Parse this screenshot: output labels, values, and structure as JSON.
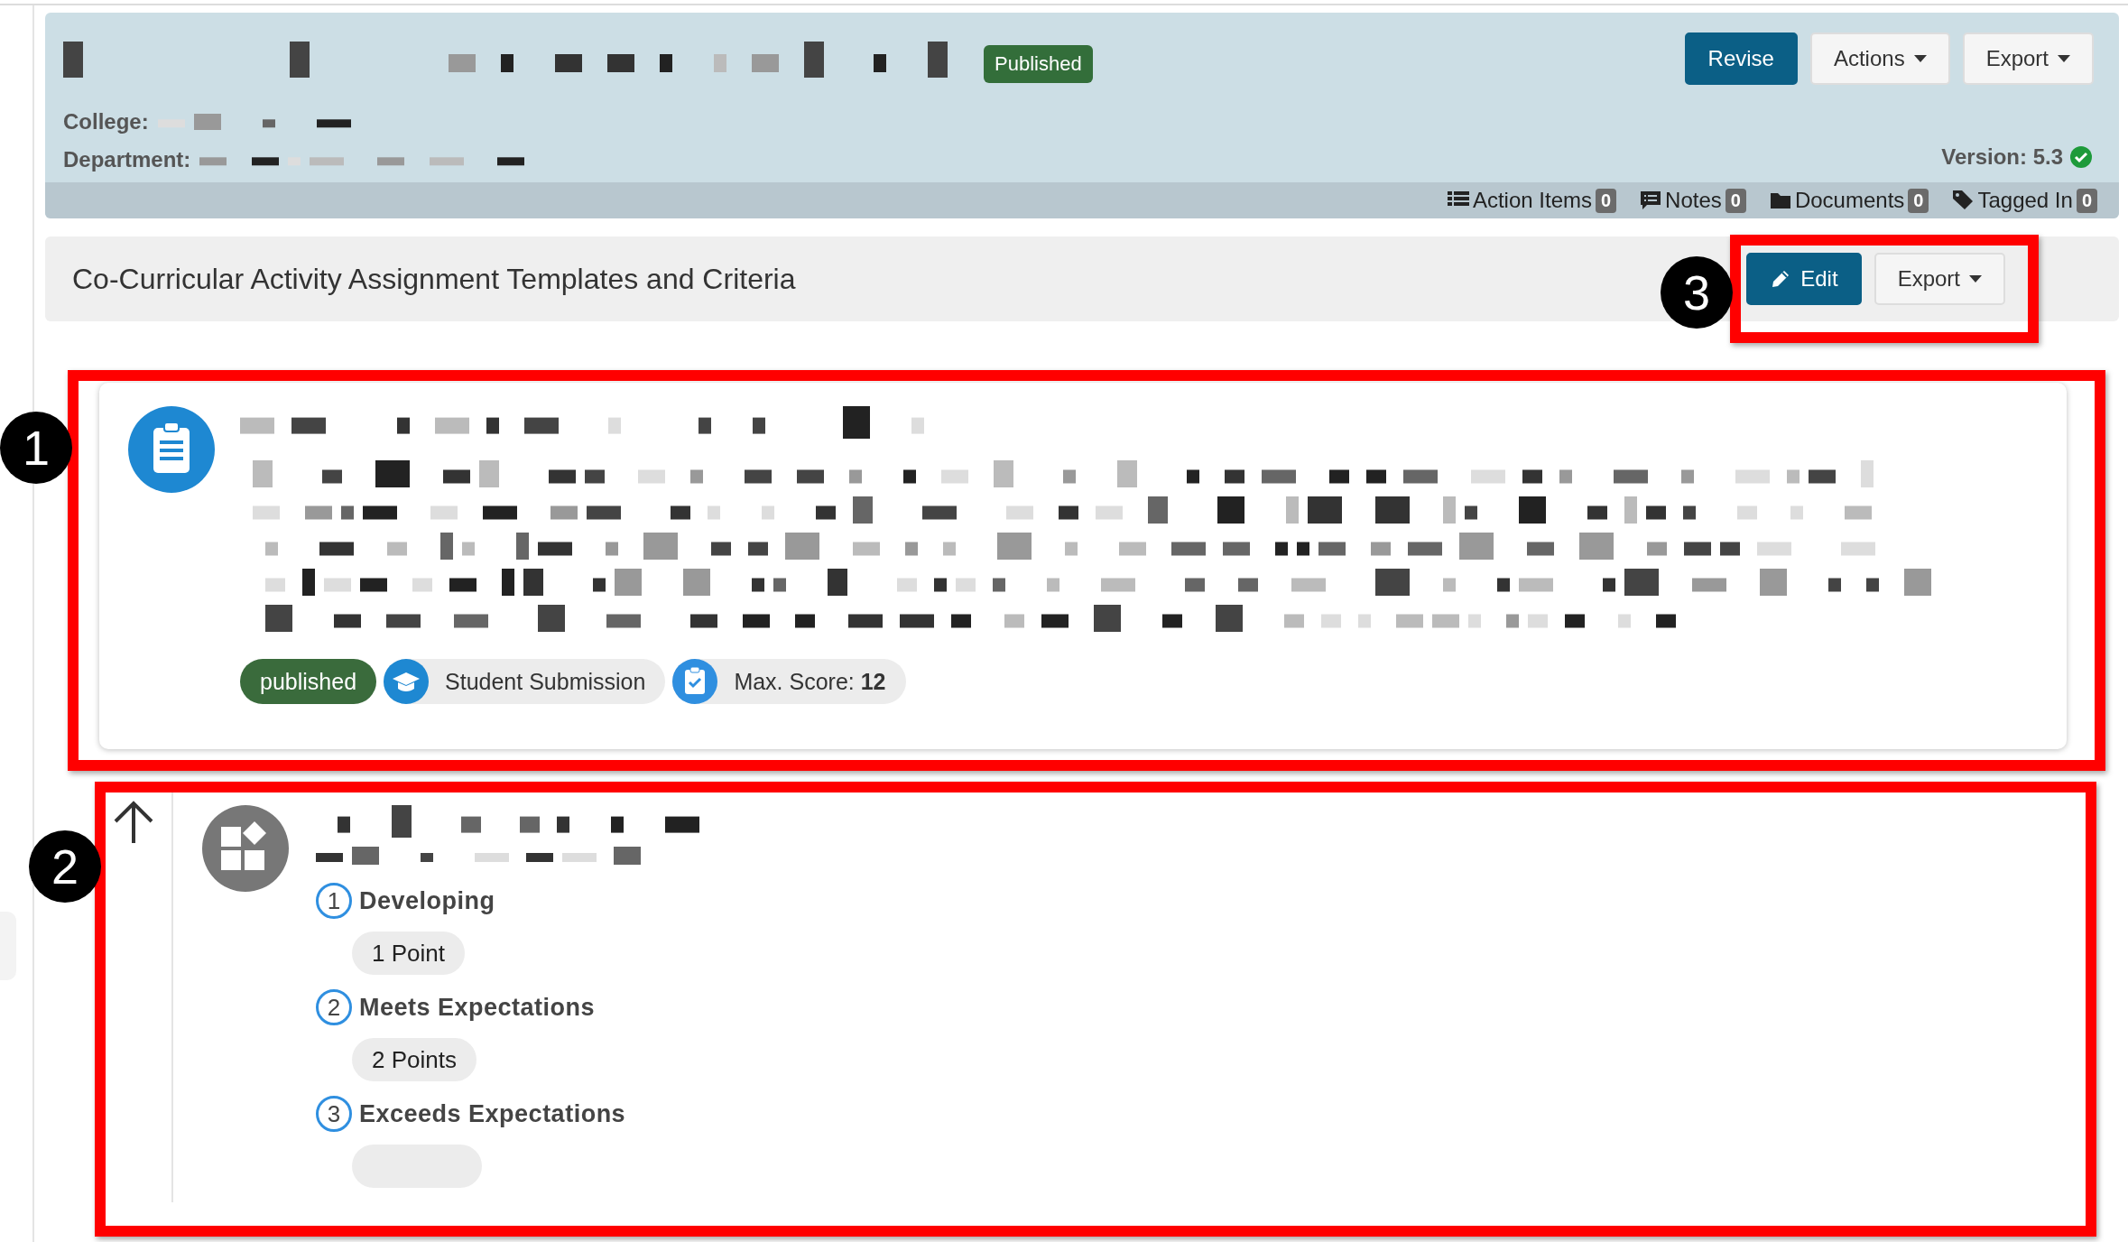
{
  "header": {
    "status": "Published",
    "buttons": [
      {
        "label": "Revise",
        "kind": "primary"
      },
      {
        "label": "Actions",
        "kind": "dropdown"
      },
      {
        "label": "Export",
        "kind": "dropdown"
      }
    ],
    "fields": [
      {
        "label": "College:"
      },
      {
        "label": "Department:"
      }
    ],
    "version": "Version: 5.3",
    "links": [
      {
        "label": "Action Items",
        "count": "0"
      },
      {
        "label": "Notes",
        "count": "0"
      },
      {
        "label": "Documents",
        "count": "0"
      },
      {
        "label": "Tagged In",
        "count": "0"
      }
    ]
  },
  "section": {
    "title": "Co-Curricular Activity Assignment Templates and Criteria",
    "buttons": [
      {
        "label": "Edit",
        "kind": "edit"
      },
      {
        "label": "Export",
        "kind": "dropdown"
      }
    ]
  },
  "assignment": {
    "status": "published",
    "type": "Student Submission",
    "score_label": "Max. Score:",
    "score": "12"
  },
  "criterion": {
    "levels": [
      {
        "number": "1",
        "name": "Developing",
        "points": "1 Point"
      },
      {
        "number": "2",
        "name": "Meets Expectations",
        "points": "2 Points"
      },
      {
        "number": "3",
        "name": "Exceeds Expectations"
      }
    ]
  },
  "annotations": [
    {
      "number": "3"
    },
    {
      "number": "1"
    },
    {
      "number": "2"
    }
  ]
}
